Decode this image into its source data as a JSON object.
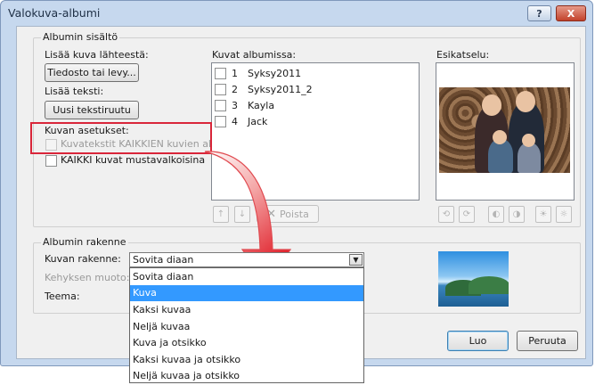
{
  "window": {
    "title": "Valokuva-albumi",
    "help_button": "?",
    "close_button": "X"
  },
  "album_content": {
    "group_title": "Albumin sisältö",
    "add_picture_label": "Lisää kuva lähteestä:",
    "file_button": "Tiedosto tai levy...",
    "add_text_label": "Lisää teksti:",
    "new_textbox_button": "Uusi tekstiruutu",
    "picture_options_label": "Kuvan asetukset:",
    "captions_below_all": "Kuvatekstit KAIKKIEN kuvien alle",
    "all_black_white": "KAIKKI kuvat mustavalkoisina"
  },
  "pictures": {
    "label": "Kuvat albumissa:",
    "items": [
      {
        "num": "1",
        "name": "Syksy2011"
      },
      {
        "num": "2",
        "name": "Syksy2011_2"
      },
      {
        "num": "3",
        "name": "Kayla"
      },
      {
        "num": "4",
        "name": "Jack"
      }
    ],
    "up_arrow": "↑",
    "down_arrow": "↓",
    "remove_button": "Poista"
  },
  "preview": {
    "label": "Esikatselu:"
  },
  "album_layout": {
    "group_title": "Albumin rakenne",
    "picture_layout_label": "Kuvan rakenne:",
    "frame_shape_label": "Kehyksen muoto:",
    "theme_label": "Teema:",
    "selected_value": "Sovita diaan",
    "options": [
      "Sovita diaan",
      "Kuva",
      "Kaksi kuvaa",
      "Neljä kuvaa",
      "Kuva ja otsikko",
      "Kaksi kuvaa ja otsikko",
      "Neljä kuvaa ja otsikko"
    ],
    "highlighted_option": "Kuva"
  },
  "footer": {
    "create_button": "Luo",
    "cancel_button": "Peruuta"
  },
  "colors": {
    "highlight": "#3399ff",
    "annotation_red": "#d9263a"
  }
}
